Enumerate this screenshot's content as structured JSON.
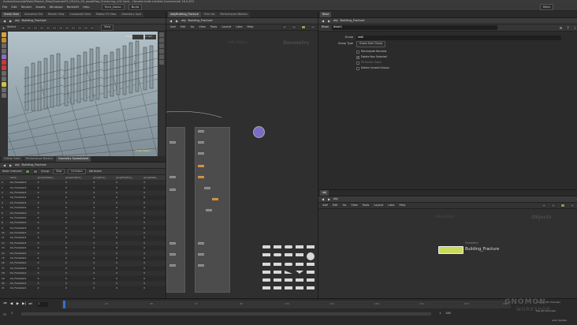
{
  "window": {
    "title": "/home/tricecold/Work/Project_Files/GnomonFX_001/ch_03_assetPrep_Fracturing_v01.hiplc - Houdini Indie Limited-Commercial 18.5.672"
  },
  "menubar": {
    "items": [
      "File",
      "Edit",
      "Render",
      "Assets",
      "Windows",
      "Redshift",
      "Help"
    ],
    "desktop": "Tech_Noise",
    "build": "Build",
    "main": "Main"
  },
  "top_left_tabs": [
    "Scene View",
    "Animation Edi",
    "Render View",
    "Composite View",
    "Motion FX View",
    "Geometry Spre"
  ],
  "left_path": {
    "obj": "obj",
    "node": "Building_Fracture"
  },
  "viewport": {
    "select": "Select",
    "view": "View",
    "persp": "Persp",
    "no_cam": "No cam",
    "footer": "Indie Edition"
  },
  "spread_tabs": [
    "Python Shell",
    "Performance Monitor",
    "Geometry Spreadsheet"
  ],
  "spread_path": {
    "obj": "obj",
    "node": "Building_Fracture"
  },
  "spread_toolbar": {
    "node": "Node: fracture1",
    "group": "Group:",
    "view": "View",
    "intrinsics": "Intrinsics",
    "attributes": "Attributes:"
  },
  "spreadsheet": {
    "columns": [
      "",
      "name",
      "groupCollision_",
      "groupCollision_",
      "groupFloor_",
      "groupFracture_",
      "groupGlass_"
    ],
    "rows": [
      [
        "0",
        "Col_FrameVar1",
        "0",
        "0",
        "0",
        "0",
        "0"
      ],
      [
        "1",
        "Col_FrameVar1",
        "0",
        "0",
        "0",
        "0",
        "0"
      ],
      [
        "2",
        "Col_FrameVar1",
        "0",
        "0",
        "0",
        "0",
        "0"
      ],
      [
        "3",
        "Col_FrameVar1",
        "0",
        "0",
        "0",
        "0",
        "0"
      ],
      [
        "4",
        "Col_FrameVar1",
        "0",
        "0",
        "0",
        "0",
        "0"
      ],
      [
        "5",
        "Col_FrameVar1",
        "0",
        "0",
        "0",
        "0",
        "0"
      ],
      [
        "6",
        "Col_FrameVar1",
        "0",
        "0",
        "0",
        "0",
        "0"
      ],
      [
        "7",
        "Col_FrameVar1",
        "0",
        "0",
        "0",
        "0",
        "0"
      ],
      [
        "8",
        "Col_FrameVar1",
        "0",
        "0",
        "0",
        "0",
        "0"
      ],
      [
        "9",
        "Col_FrameVar1",
        "0",
        "0",
        "0",
        "0",
        "0"
      ],
      [
        "10",
        "Col_FrameVar1",
        "0",
        "0",
        "0",
        "0",
        "0"
      ],
      [
        "11",
        "Col_FrameVar1",
        "0",
        "0",
        "0",
        "0",
        "0"
      ],
      [
        "12",
        "Col_FrameVar1",
        "0",
        "0",
        "0",
        "0",
        "0"
      ],
      [
        "13",
        "Col_FrameVar1",
        "0",
        "0",
        "0",
        "0",
        "0"
      ],
      [
        "14",
        "Col_FrameVar1",
        "0",
        "0",
        "0",
        "0",
        "0"
      ],
      [
        "15",
        "Col_FrameVar1",
        "0",
        "0",
        "0",
        "0",
        "0"
      ],
      [
        "16",
        "Col_FrameVar1",
        "0",
        "0",
        "0",
        "0",
        "0"
      ],
      [
        "17",
        "Col_FrameVar1",
        "0",
        "0",
        "0",
        "0",
        "0"
      ],
      [
        "18",
        "Col_FrameVar1",
        "0",
        "0",
        "0",
        "0",
        "0"
      ],
      [
        "19",
        "Col_FrameVar1",
        "0",
        "0",
        "0",
        "0",
        "0"
      ],
      [
        "20",
        "Col_FrameVar1",
        "0",
        "0",
        "0",
        "0",
        "0"
      ],
      [
        "21",
        "Col_FrameVar1",
        "0",
        "0",
        "0",
        "0",
        "0"
      ]
    ]
  },
  "mid_tabs": [
    "/obj/Building_Fracture",
    "Tree List",
    "Performance Monitor"
  ],
  "mid_path": {
    "obj": "obj",
    "node": "Building_Fracture"
  },
  "mid_menu": [
    "Add",
    "Edit",
    "Go",
    "View",
    "Tools",
    "Layout",
    "Labs",
    "Help"
  ],
  "mid_net": {
    "watermark": "Indie Edition",
    "context": "Geometry"
  },
  "param_tabs": [
    "Blast"
  ],
  "param_path": {
    "obj": "obj",
    "node": "Building_Fracture"
  },
  "param": {
    "node_type": "Blast",
    "node_name": "blast1",
    "group_label": "Group",
    "group_value": "wall",
    "group_type_label": "Group Type",
    "group_type_value": "Guess from Group",
    "toggles": [
      {
        "label": "Recompute Normals",
        "checked": false
      },
      {
        "label": "Delete Non Selected",
        "checked": true
      },
      {
        "label": "Fill Border Holes",
        "checked": false
      },
      {
        "label": "Delete Unused Groups",
        "checked": false
      }
    ]
  },
  "obj_tabs": [
    "obj"
  ],
  "obj_path": {
    "obj": "obj"
  },
  "obj_menu": [
    "Add",
    "Edit",
    "Go",
    "View",
    "Tools",
    "Layout",
    "Labs",
    "Help"
  ],
  "obj_net": {
    "watermark": "Indie Edition",
    "context": "Objects",
    "node_type": "Geometry",
    "node_name": "Building_Fracture"
  },
  "timeline": {
    "frame": "1",
    "start": "1",
    "end": "240",
    "ticks": [
      "24",
      "48",
      "72",
      "96",
      "120",
      "144",
      "168",
      "192",
      "216",
      "240"
    ],
    "range_start": "1",
    "range_end": "240"
  },
  "statusbar": {
    "keys": "0 keys, 0/0 channels",
    "key_all": "Key All Channels",
    "auto_update": "Auto Update"
  },
  "watermark": {
    "brand": "GNOMON",
    "sub": "WORKSHOP"
  }
}
